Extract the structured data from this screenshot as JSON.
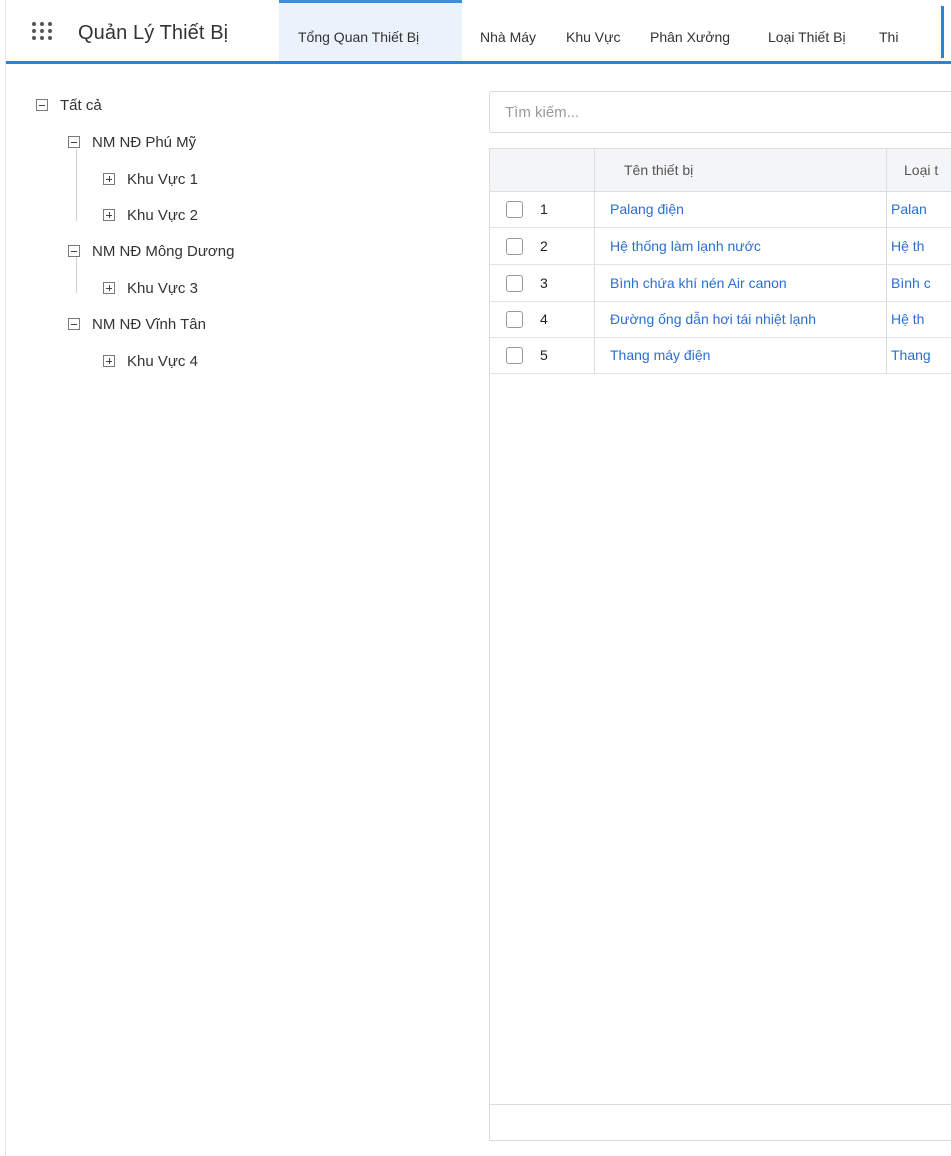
{
  "header": {
    "app_title": "Quản Lý Thiết Bị",
    "tabs": [
      {
        "label": "Tổng Quan Thiết Bị",
        "active": true
      },
      {
        "label": "Nhà Máy",
        "active": false
      },
      {
        "label": "Khu Vực",
        "active": false
      },
      {
        "label": "Phân Xưởng",
        "active": false
      },
      {
        "label": "Loại Thiết Bị",
        "active": false
      },
      {
        "label": "Thi",
        "active": false
      }
    ]
  },
  "tree": {
    "root": {
      "label": "Tất cả",
      "expanded": true
    },
    "plants": [
      {
        "label": "NM NĐ Phú Mỹ",
        "expanded": true,
        "areas": [
          {
            "label": "Khu Vực 1",
            "expanded": false
          },
          {
            "label": "Khu Vực 2",
            "expanded": false
          }
        ]
      },
      {
        "label": "NM NĐ Mông Dương",
        "expanded": true,
        "areas": [
          {
            "label": "Khu Vực 3",
            "expanded": false
          }
        ]
      },
      {
        "label": "NM NĐ Vĩnh Tân",
        "expanded": true,
        "areas": [
          {
            "label": "Khu Vực 4",
            "expanded": false
          }
        ]
      }
    ]
  },
  "search": {
    "placeholder": "Tìm kiếm...",
    "value": ""
  },
  "table": {
    "columns": [
      "",
      "Tên thiết bị",
      "Loại t"
    ],
    "rows": [
      {
        "no": "1",
        "name": "Palang điện",
        "type": "Palan",
        "checked": false
      },
      {
        "no": "2",
        "name": "Hệ thống làm lạnh nước",
        "type": "Hệ th",
        "checked": false
      },
      {
        "no": "3",
        "name": "Bình chứa khí nén Air canon",
        "type": "Bình c",
        "checked": false
      },
      {
        "no": "4",
        "name": "Đường ống dẫn hơi tái nhiệt lạnh",
        "type": "Hệ th",
        "checked": false
      },
      {
        "no": "5",
        "name": "Thang máy điện",
        "type": "Thang",
        "checked": false
      }
    ]
  },
  "colors": {
    "accent": "#2f80d6",
    "link": "#2a6fd0",
    "active_tab_bg": "#eaf2fb"
  }
}
